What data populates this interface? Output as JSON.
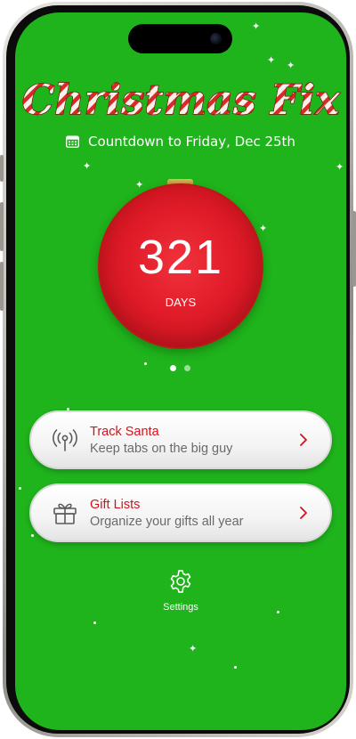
{
  "app": {
    "title": "Christmas Fix",
    "subtitle": "Countdown to Friday, Dec 25th"
  },
  "countdown": {
    "value": "321",
    "unit": "DAYS"
  },
  "pager": {
    "pages": 2,
    "active": 1
  },
  "cards": [
    {
      "title": "Track Santa",
      "subtitle": "Keep tabs on the big guy",
      "icon": "antenna-icon"
    },
    {
      "title": "Gift Lists",
      "subtitle": "Organize your gifts all year",
      "icon": "gift-icon"
    }
  ],
  "settings": {
    "label": "Settings",
    "icon": "gear-icon"
  },
  "colors": {
    "background": "#1fb31c",
    "ornament": "#e11c29",
    "accent_text": "#d2131d"
  }
}
